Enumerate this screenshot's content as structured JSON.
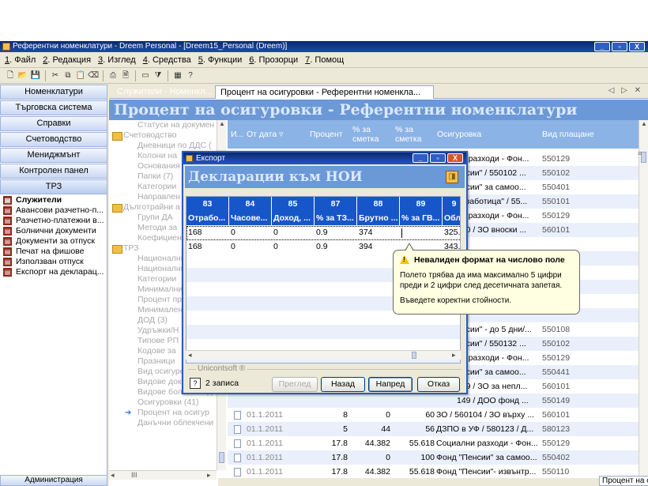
{
  "window": {
    "title": "Референтни номенклатури - Dreem Personal - [Dreem15_Personal (Dreem)]",
    "buttons": [
      "_",
      "▫",
      "X"
    ]
  },
  "menubar": [
    {
      "key": "1",
      "label": "Файл"
    },
    {
      "key": "2",
      "label": "Редакция"
    },
    {
      "key": "3",
      "label": "Изглед"
    },
    {
      "key": "4",
      "label": "Средства"
    },
    {
      "key": "5",
      "label": "Функции"
    },
    {
      "key": "6",
      "label": "Прозорци"
    },
    {
      "key": "7",
      "label": "Помощ"
    }
  ],
  "toolbar": {
    "icons": [
      "new-document-icon",
      "open-folder-icon",
      "save-icon",
      "cut-icon",
      "copy-icon",
      "paste-icon",
      "eraser-icon",
      "print-icon",
      "print-preview-icon",
      "window-icon",
      "filter-icon",
      "calculator-icon",
      "help-icon"
    ]
  },
  "left_nav": {
    "buttons": [
      "Номенклатури",
      "Търговска система",
      "Справки",
      "Счетоводство",
      "Мениджмънт",
      "Контролен панел",
      "ТРЗ"
    ],
    "active": "ТРЗ",
    "sub_items": [
      {
        "label": "Служители",
        "bold": true
      },
      {
        "label": "Авансови разчетно-п..."
      },
      {
        "label": "Разчетно-платежни в..."
      },
      {
        "label": "Болнични документи"
      },
      {
        "label": "Документи за отпуск"
      },
      {
        "label": "Печат на фишове"
      },
      {
        "label": "Използван отпуск"
      },
      {
        "label": "Експорт на декларац..."
      }
    ],
    "bottom_button": "Администрация"
  },
  "tabs": {
    "inactive": "Служители - Номенкл...",
    "active": "Процент на осигуровки - Референтни номенкла...",
    "nav": "◁ ▷ ✕"
  },
  "banner": "Процент на осигуровки - Референтни номенклатури",
  "tree": [
    {
      "label": "Статуси на докумен",
      "level": 2
    },
    {
      "label": "Счетоводство",
      "level": 1
    },
    {
      "label": "Дневници по ДДС (",
      "level": 2
    },
    {
      "label": "Колони на",
      "level": 2
    },
    {
      "label": "Основания",
      "level": 2
    },
    {
      "label": "Папки  (7)",
      "level": 2
    },
    {
      "label": "Категории",
      "level": 2
    },
    {
      "label": "Направлен",
      "level": 2
    },
    {
      "label": "Дълготрайни а",
      "level": 1
    },
    {
      "label": "Групи ДА",
      "level": 2
    },
    {
      "label": "Методи за",
      "level": 2
    },
    {
      "label": "Коефициен",
      "level": 2
    },
    {
      "label": "ТРЗ",
      "level": 1
    },
    {
      "label": "Национални",
      "level": 2
    },
    {
      "label": "Национални",
      "level": 2
    },
    {
      "label": "Категории",
      "level": 2
    },
    {
      "label": "Минимални",
      "level": 2
    },
    {
      "label": "Процент пр",
      "level": 2
    },
    {
      "label": "Минимален",
      "level": 2
    },
    {
      "label": "ДОД  (3)",
      "level": 2
    },
    {
      "label": "Удръжки/Н",
      "level": 2
    },
    {
      "label": "Типове РП",
      "level": 2
    },
    {
      "label": "Кодове за",
      "level": 2
    },
    {
      "label": "Празници",
      "level": 2
    },
    {
      "label": "Вид осигурен  (2)",
      "level": 2
    },
    {
      "label": "Видове документи з",
      "level": 2
    },
    {
      "label": "Видове болнични до",
      "level": 2
    },
    {
      "label": "Осигуровки  (41)",
      "level": 2
    },
    {
      "label": "Процент на осигур",
      "level": 3
    },
    {
      "label": "Данъчни облекчени",
      "level": 2
    }
  ],
  "grid": {
    "headers": [
      "И...",
      "От дата ▿",
      "Процент",
      "% за сметка",
      "% за сметка",
      "Осигуровка",
      "Вид плащане"
    ],
    "partial_rows": [
      {
        "osig": "ни разходи - Фон...",
        "vid": "550129"
      },
      {
        "osig": "енсии\" / 550102 ...",
        "vid": "550102"
      },
      {
        "osig": "енсии\" за самоо...",
        "vid": "550401"
      },
      {
        "osig": "езработица\" / 55...",
        "vid": "550101"
      },
      {
        "osig": "ни разходи - Фон...",
        "vid": "550129"
      },
      {
        "osig": "200 / ЗО вноски ...",
        "vid": "560101"
      },
      {
        "osig": "",
        "vid": ""
      },
      {
        "osig": "",
        "vid": ""
      },
      {
        "osig": "",
        "vid": ""
      },
      {
        "osig": "",
        "vid": ""
      },
      {
        "osig": "",
        "vid": ""
      },
      {
        "osig": "",
        "vid": ""
      },
      {
        "osig": "енсии\" - до 5 дни/...",
        "vid": "550108"
      },
      {
        "osig": "енсии\" / 550132 ...",
        "vid": "550102"
      },
      {
        "osig": "ни разходи - Фон...",
        "vid": "550129"
      },
      {
        "osig": "енсии\" за самоо...",
        "vid": "550441"
      },
      {
        "osig": "109 / ЗО за непл...",
        "vid": "560101"
      },
      {
        "osig": "149 / ДОО фонд ...",
        "vid": "550149"
      }
    ],
    "full_rows": [
      {
        "date": "01.1.2011",
        "p": "8",
        "a": "0",
        "b": "60",
        "osig": "ЗО / 560104 / ЗО въpху ...",
        "vid": "560101"
      },
      {
        "date": "01.1.2011",
        "p": "5",
        "a": "44",
        "b": "56",
        "osig": "ДЗПО в УФ / 580123 / Д...",
        "vid": "580123"
      },
      {
        "date": "01.1.2011",
        "p": "17.8",
        "a": "44.382",
        "b": "55.618",
        "osig": "Социални разходи - Фон...",
        "vid": "550129"
      },
      {
        "date": "01.1.2011",
        "p": "17.8",
        "a": "0",
        "b": "100",
        "osig": "Фонд \"Пенсии\" за самоо...",
        "vid": "550402"
      },
      {
        "date": "01.1.2011",
        "p": "17.8",
        "a": "44.382",
        "b": "55.618",
        "osig": "Фонд \"Пенсии\"- извънтр...",
        "vid": "550110"
      },
      {
        "date": "01.1.2011",
        "p": "0",
        "a": "0",
        "b": "0",
        "osig": "ГВРС / 570910 / Фонд 'Г...",
        "vid": "570910"
      }
    ]
  },
  "dialog": {
    "title": "Експорт",
    "banner": "Декларации към НОИ",
    "col_numbers": [
      "83",
      "84",
      "85",
      "87",
      "88",
      "89",
      "9"
    ],
    "col_names": [
      "Отрабо...",
      "Часове...",
      "Доход, ...",
      "% за ТЗ...",
      "Брутно ...",
      "% за ГВ...",
      "Обла"
    ],
    "rows": [
      [
        "168",
        "0",
        "0",
        "0.9",
        "374",
        "",
        "325.'"
      ],
      [
        "168",
        "0",
        "0",
        "0.9",
        "394",
        "",
        "343.'"
      ]
    ],
    "legend": "Unicontsoft ®",
    "record_count": "2 записа",
    "buttons": {
      "preview": "Преглед",
      "back": "Назад",
      "next": "Напред",
      "cancel": "Отказ"
    }
  },
  "tooltip": {
    "title": "Невалиден формат на числово поле",
    "body1": "Полето трябва да има максимално 5 цифри преди и 2 цифри след десетичната запетая.",
    "body2": "Въведете коректни стойности."
  },
  "status": {
    "tab": "Процент на осигуровки"
  }
}
